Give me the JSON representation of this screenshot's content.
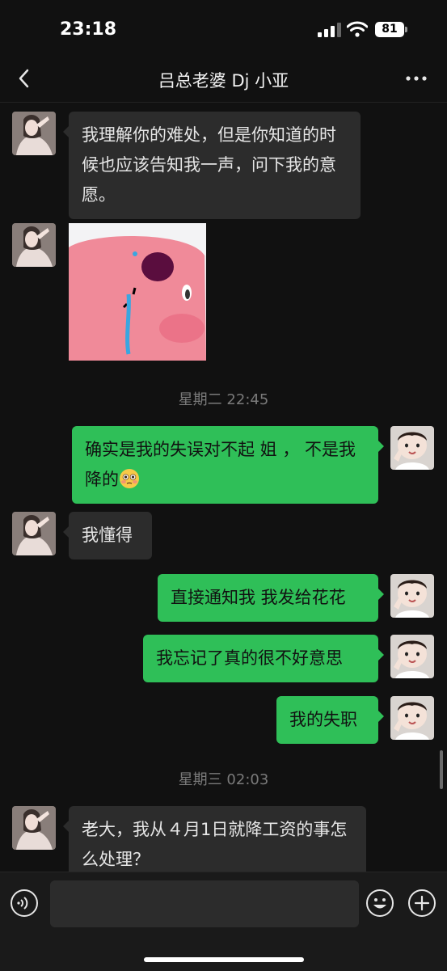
{
  "status": {
    "time": "23:18",
    "battery": "81"
  },
  "nav": {
    "title": "吕总老婆 Dj 小亚"
  },
  "messages": [
    {
      "side": "in",
      "text": "我理解你的难处，但是你知道的时候也应该告知我一声，问下我的意愿。"
    },
    {
      "side": "in",
      "type": "sticker",
      "icon": "crying-pink-blob-sticker"
    },
    {
      "type": "time",
      "text": "星期二 22:45"
    },
    {
      "side": "out",
      "text": "确实是我的失误对不起 姐 ， 不是我降的",
      "emoji": "flushed-face-emoji"
    },
    {
      "side": "in",
      "text": "我懂得"
    },
    {
      "side": "out",
      "text": "直接通知我 我发给花花"
    },
    {
      "side": "out",
      "text": "我忘记了真的很不好意思"
    },
    {
      "side": "out",
      "text": "我的失职"
    },
    {
      "type": "time",
      "text": "星期三 02:03"
    },
    {
      "side": "in",
      "text": "老大，我从４月1日就降工资的事怎么处理？"
    }
  ],
  "input": {
    "placeholder": ""
  },
  "colors": {
    "background": "#111111",
    "incoming_bubble": "#2c2c2c",
    "outgoing_bubble": "#2fbf58"
  }
}
